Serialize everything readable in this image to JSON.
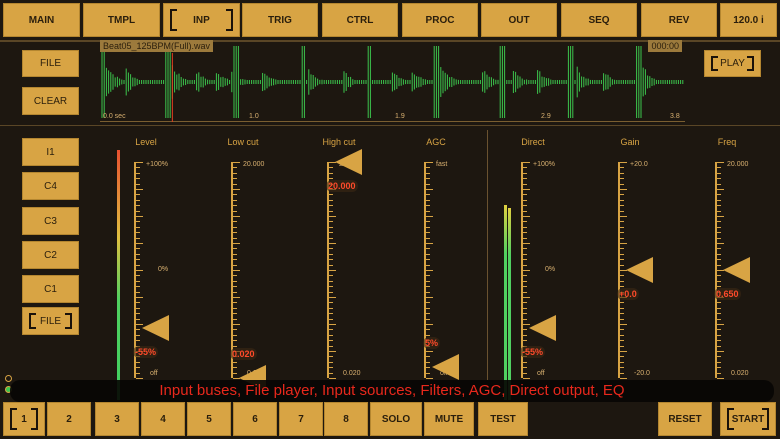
{
  "tabs": [
    {
      "label": "MAIN"
    },
    {
      "label": "TMPL"
    },
    {
      "label": "INP",
      "selected": true
    },
    {
      "label": "TRIG"
    },
    {
      "label": "CTRL"
    },
    {
      "label": "PROC"
    },
    {
      "label": "OUT"
    },
    {
      "label": "SEQ"
    },
    {
      "label": "REV"
    },
    {
      "label": "120.0 i"
    }
  ],
  "file_player": {
    "file_button": "FILE",
    "clear_button": "CLEAR",
    "play_button": "PLAY",
    "filename": "Beat05_125BPM(Full).wav",
    "time": "000:00",
    "time_marks": [
      "0.0 sec",
      "1.0",
      "1.9",
      "2.9",
      "3.8"
    ],
    "playhead_position_sec": 0.47,
    "duration_sec": 3.8
  },
  "sources": [
    {
      "label": "I1"
    },
    {
      "label": "C4"
    },
    {
      "label": "C3"
    },
    {
      "label": "C2"
    },
    {
      "label": "C1"
    },
    {
      "label": "FILE",
      "selected": true
    }
  ],
  "sliders": [
    {
      "label": "Level",
      "top": "+100%",
      "mid": "0%",
      "bottom": "off",
      "value": "-55%",
      "fraction": 0.23
    },
    {
      "label": "Low cut",
      "top": "20.000",
      "mid": "",
      "bottom": "0.020",
      "value": "0.020",
      "fraction": 0.0
    },
    {
      "label": "High cut",
      "top": "20.000",
      "mid": "",
      "bottom": "0.020",
      "value": "20.000",
      "fraction": 1.0
    },
    {
      "label": "AGC",
      "top": "fast",
      "mid": "",
      "bottom": "off",
      "value": "5%",
      "fraction": 0.05
    },
    {
      "label": "Direct",
      "top": "+100%",
      "mid": "0%",
      "bottom": "off",
      "value": "-55%",
      "fraction": 0.23
    },
    {
      "label": "Gain",
      "top": "+20.0",
      "mid": "",
      "bottom": "-20.0",
      "value": "+0.0",
      "fraction": 0.5
    },
    {
      "label": "Freq",
      "top": "20.000",
      "mid": "",
      "bottom": "0.020",
      "value": "0.650",
      "fraction": 0.5
    }
  ],
  "caption": "Input buses, File player, Input sources, Filters, AGC, Direct output, EQ",
  "bottom": {
    "buses": [
      {
        "label": "1",
        "selected": true
      },
      {
        "label": "2"
      },
      {
        "label": "3"
      },
      {
        "label": "4"
      },
      {
        "label": "5"
      },
      {
        "label": "6"
      },
      {
        "label": "7"
      },
      {
        "label": "8"
      }
    ],
    "solo": "SOLO",
    "mute": "MUTE",
    "test": "TEST",
    "reset": "RESET",
    "start": "START"
  },
  "colors": {
    "accent": "#d8a444",
    "background": "#1d1710",
    "value": "#ff4a2a",
    "wave": "#3cc44c",
    "caption": "#e8281c"
  }
}
